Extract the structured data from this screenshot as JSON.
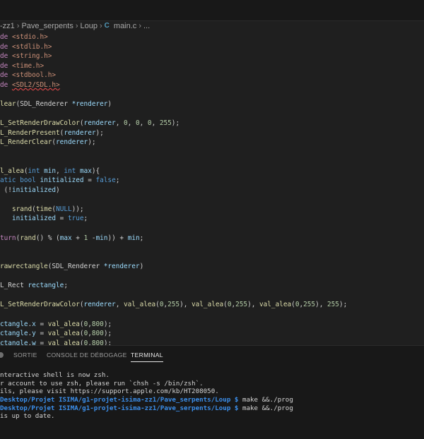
{
  "breadcrumb": {
    "items": [
      "-zz1",
      "Pave_serpents",
      "Loup",
      "main.c",
      "..."
    ],
    "file_icon": "C"
  },
  "code_lines": [
    [
      {
        "c": "kw",
        "t": "de "
      },
      {
        "c": "inc",
        "t": "<stdio.h>"
      }
    ],
    [
      {
        "c": "kw",
        "t": "de "
      },
      {
        "c": "inc",
        "t": "<stdlib.h>"
      }
    ],
    [
      {
        "c": "kw",
        "t": "de "
      },
      {
        "c": "inc",
        "t": "<string.h>"
      }
    ],
    [
      {
        "c": "kw",
        "t": "de "
      },
      {
        "c": "inc",
        "t": "<time.h>"
      }
    ],
    [
      {
        "c": "kw",
        "t": "de "
      },
      {
        "c": "inc",
        "t": "<stdbool.h>"
      }
    ],
    [
      {
        "c": "kw",
        "t": "de "
      },
      {
        "c": "err",
        "t": "<SDL2/SDL.h>"
      }
    ],
    [],
    [
      {
        "c": "fn",
        "t": "lear"
      },
      {
        "c": "plain",
        "t": "("
      },
      {
        "c": "plain",
        "t": "SDL_Renderer "
      },
      {
        "c": "var",
        "t": "*renderer"
      },
      {
        "c": "plain",
        "t": ")"
      }
    ],
    [],
    [
      {
        "c": "fn",
        "t": "L_SetRenderDrawColor"
      },
      {
        "c": "plain",
        "t": "("
      },
      {
        "c": "var",
        "t": "renderer"
      },
      {
        "c": "plain",
        "t": ", "
      },
      {
        "c": "num",
        "t": "0"
      },
      {
        "c": "plain",
        "t": ", "
      },
      {
        "c": "num",
        "t": "0"
      },
      {
        "c": "plain",
        "t": ", "
      },
      {
        "c": "num",
        "t": "0"
      },
      {
        "c": "plain",
        "t": ", "
      },
      {
        "c": "num",
        "t": "255"
      },
      {
        "c": "plain",
        "t": ");"
      }
    ],
    [
      {
        "c": "fn",
        "t": "L_RenderPresent"
      },
      {
        "c": "plain",
        "t": "("
      },
      {
        "c": "var",
        "t": "renderer"
      },
      {
        "c": "plain",
        "t": ");"
      }
    ],
    [
      {
        "c": "fn",
        "t": "L_RenderClear"
      },
      {
        "c": "plain",
        "t": "("
      },
      {
        "c": "var",
        "t": "renderer"
      },
      {
        "c": "plain",
        "t": ");"
      }
    ],
    [],
    [],
    [
      {
        "c": "fn",
        "t": "l_alea"
      },
      {
        "c": "plain",
        "t": "("
      },
      {
        "c": "type",
        "t": "int"
      },
      {
        "c": "plain",
        "t": " "
      },
      {
        "c": "var",
        "t": "min"
      },
      {
        "c": "plain",
        "t": ", "
      },
      {
        "c": "type",
        "t": "int"
      },
      {
        "c": "plain",
        "t": " "
      },
      {
        "c": "var",
        "t": "max"
      },
      {
        "c": "plain",
        "t": "){"
      }
    ],
    [
      {
        "c": "type",
        "t": "atic bool"
      },
      {
        "c": "plain",
        "t": " "
      },
      {
        "c": "var",
        "t": "initialized"
      },
      {
        "c": "plain",
        "t": " = "
      },
      {
        "c": "type",
        "t": "false"
      },
      {
        "c": "plain",
        "t": ";"
      }
    ],
    [
      {
        "c": "plain",
        "t": " ("
      },
      {
        "c": "plain",
        "t": "!"
      },
      {
        "c": "var",
        "t": "initialized"
      },
      {
        "c": "plain",
        "t": ")"
      }
    ],
    [],
    [
      {
        "c": "plain",
        "t": "   "
      },
      {
        "c": "fn",
        "t": "srand"
      },
      {
        "c": "plain",
        "t": "("
      },
      {
        "c": "fn",
        "t": "time"
      },
      {
        "c": "plain",
        "t": "("
      },
      {
        "c": "type",
        "t": "NULL"
      },
      {
        "c": "plain",
        "t": "));"
      }
    ],
    [
      {
        "c": "plain",
        "t": "   "
      },
      {
        "c": "var",
        "t": "initialized"
      },
      {
        "c": "plain",
        "t": " = "
      },
      {
        "c": "type",
        "t": "true"
      },
      {
        "c": "plain",
        "t": ";"
      }
    ],
    [],
    [
      {
        "c": "kw",
        "t": "turn"
      },
      {
        "c": "plain",
        "t": "("
      },
      {
        "c": "fn",
        "t": "rand"
      },
      {
        "c": "plain",
        "t": "() % ("
      },
      {
        "c": "var",
        "t": "max"
      },
      {
        "c": "plain",
        "t": " + "
      },
      {
        "c": "num",
        "t": "1"
      },
      {
        "c": "plain",
        "t": " -"
      },
      {
        "c": "var",
        "t": "min"
      },
      {
        "c": "plain",
        "t": ")) + "
      },
      {
        "c": "var",
        "t": "min"
      },
      {
        "c": "plain",
        "t": ";"
      }
    ],
    [],
    [],
    [
      {
        "c": "fn",
        "t": "rawrectangle"
      },
      {
        "c": "plain",
        "t": "("
      },
      {
        "c": "plain",
        "t": "SDL_Renderer "
      },
      {
        "c": "var",
        "t": "*renderer"
      },
      {
        "c": "plain",
        "t": ")"
      }
    ],
    [],
    [
      {
        "c": "plain",
        "t": "L_Rect "
      },
      {
        "c": "var",
        "t": "rectangle"
      },
      {
        "c": "plain",
        "t": ";"
      }
    ],
    [],
    [
      {
        "c": "fn",
        "t": "L_SetRenderDrawColor"
      },
      {
        "c": "plain",
        "t": "("
      },
      {
        "c": "var",
        "t": "renderer"
      },
      {
        "c": "plain",
        "t": ", "
      },
      {
        "c": "fn",
        "t": "val_alea"
      },
      {
        "c": "plain",
        "t": "("
      },
      {
        "c": "num",
        "t": "0"
      },
      {
        "c": "plain",
        "t": ","
      },
      {
        "c": "num",
        "t": "255"
      },
      {
        "c": "plain",
        "t": "), "
      },
      {
        "c": "fn",
        "t": "val_alea"
      },
      {
        "c": "plain",
        "t": "("
      },
      {
        "c": "num",
        "t": "0"
      },
      {
        "c": "plain",
        "t": ","
      },
      {
        "c": "num",
        "t": "255"
      },
      {
        "c": "plain",
        "t": "), "
      },
      {
        "c": "fn",
        "t": "val_alea"
      },
      {
        "c": "plain",
        "t": "("
      },
      {
        "c": "num",
        "t": "0"
      },
      {
        "c": "plain",
        "t": ","
      },
      {
        "c": "num",
        "t": "255"
      },
      {
        "c": "plain",
        "t": "), "
      },
      {
        "c": "num",
        "t": "255"
      },
      {
        "c": "plain",
        "t": ");"
      }
    ],
    [],
    [
      {
        "c": "var",
        "t": "ctangle"
      },
      {
        "c": "plain",
        "t": "."
      },
      {
        "c": "var",
        "t": "x"
      },
      {
        "c": "plain",
        "t": " = "
      },
      {
        "c": "fn",
        "t": "val_alea"
      },
      {
        "c": "plain",
        "t": "("
      },
      {
        "c": "num",
        "t": "0"
      },
      {
        "c": "plain",
        "t": ","
      },
      {
        "c": "num",
        "t": "800"
      },
      {
        "c": "plain",
        "t": ");"
      }
    ],
    [
      {
        "c": "var",
        "t": "ctangle"
      },
      {
        "c": "plain",
        "t": "."
      },
      {
        "c": "var",
        "t": "y"
      },
      {
        "c": "plain",
        "t": " = "
      },
      {
        "c": "fn",
        "t": "val_alea"
      },
      {
        "c": "plain",
        "t": "("
      },
      {
        "c": "num",
        "t": "0"
      },
      {
        "c": "plain",
        "t": ","
      },
      {
        "c": "num",
        "t": "800"
      },
      {
        "c": "plain",
        "t": ");"
      }
    ],
    [
      {
        "c": "var",
        "t": "ctangle"
      },
      {
        "c": "plain",
        "t": "."
      },
      {
        "c": "var",
        "t": "w"
      },
      {
        "c": "plain",
        "t": " = "
      },
      {
        "c": "fn",
        "t": "val_alea"
      },
      {
        "c": "plain",
        "t": "("
      },
      {
        "c": "num",
        "t": "0"
      },
      {
        "c": "plain",
        "t": ","
      },
      {
        "c": "num",
        "t": "800"
      },
      {
        "c": "plain",
        "t": ");"
      }
    ]
  ],
  "panel": {
    "tabs": [
      {
        "label": "SORTIE",
        "active": false
      },
      {
        "label": "CONSOLE DE DÉBOGAGE",
        "active": false
      },
      {
        "label": "TERMINAL",
        "active": true
      }
    ]
  },
  "terminal": {
    "lines": [
      [
        {
          "c": "plain",
          "t": "nteractive shell is now zsh."
        }
      ],
      [
        {
          "c": "plain",
          "t": "r account to use zsh, please run `chsh -s /bin/zsh`."
        }
      ],
      [
        {
          "c": "plain",
          "t": "ils, please visit https://support.apple.com/kb/HT208050."
        }
      ],
      [
        {
          "c": "path",
          "t": "Desktop/Projet ISIMA/g1-projet-isima-zz1/Pave_serpents/Loup $"
        },
        {
          "c": "plain",
          "t": " make &&./prog"
        }
      ],
      [
        {
          "c": "path",
          "t": "Desktop/Projet ISIMA/g1-projet-isima-zz1/Pave_serpents/Loup $"
        },
        {
          "c": "plain",
          "t": " make &&./prog"
        }
      ],
      [
        {
          "c": "plain",
          "t": "is up to date."
        }
      ]
    ]
  },
  "colors": {
    "keyword": "#c586c0",
    "string": "#ce9178",
    "type": "#569cd6",
    "function": "#dcdcaa",
    "variable": "#9cdcfe",
    "number": "#b5cea8",
    "terminal_path": "#3b8eea"
  }
}
